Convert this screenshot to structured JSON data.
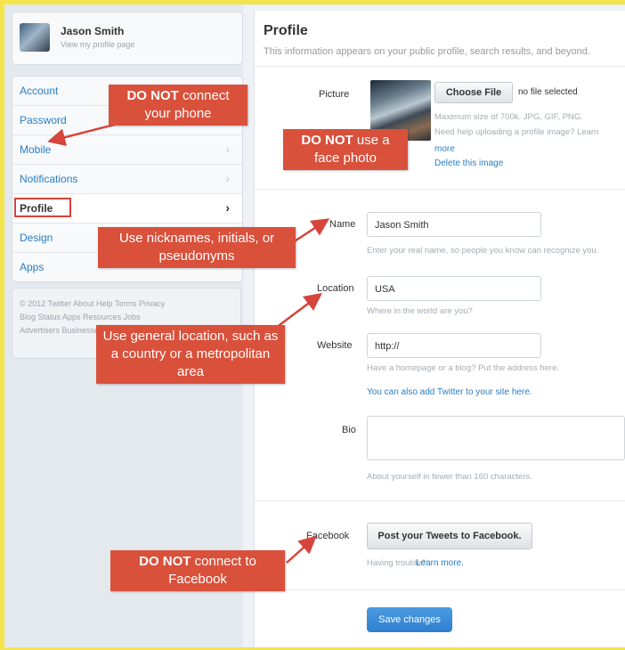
{
  "user": {
    "name": "Jason Smith",
    "subtitle": "View my profile page"
  },
  "nav": [
    {
      "label": "Account"
    },
    {
      "label": "Password"
    },
    {
      "label": "Mobile"
    },
    {
      "label": "Notifications"
    },
    {
      "label": "Profile",
      "active": true
    },
    {
      "label": "Design"
    },
    {
      "label": "Apps"
    }
  ],
  "footer": {
    "lines": [
      "© 2012 Twitter  About  Help  Terms  Privacy",
      "Blog  Status  Apps  Resources  Jobs",
      "Advertisers  Businesses  Media  Developers"
    ]
  },
  "profile": {
    "title": "Profile",
    "subtitle": "This information appears on your public profile, search results, and beyond.",
    "picture": {
      "label": "Picture",
      "choose_button": "Choose File",
      "no_file": "no file selected",
      "hint1": "Maximum size of 700k. JPG, GIF, PNG.",
      "hint2": "Need help uploading a profile image? Learn",
      "hint2_link": "more",
      "delete_link": "Delete this image"
    },
    "name": {
      "label": "Name",
      "value": "Jason Smith",
      "hint": "Enter your real name, so people you know can recognize you."
    },
    "location": {
      "label": "Location",
      "value": "USA",
      "hint": "Where in the world are you?"
    },
    "website": {
      "label": "Website",
      "value": "http://",
      "hint": "Have a homepage or a blog? Put the address here.",
      "link": "You can also add Twitter to your site here."
    },
    "bio": {
      "label": "Bio",
      "value": "",
      "hint": "About yourself in fewer than 160 characters."
    },
    "facebook": {
      "label": "Facebook",
      "button": "Post your Tweets to Facebook.",
      "hint": "Having trouble?",
      "hint_link": "Learn more."
    },
    "save_button": "Save changes"
  },
  "callouts": {
    "phone": {
      "strong": "DO NOT",
      "rest": " connect your phone"
    },
    "photo": {
      "strong": "DO NOT",
      "rest": " use a face photo"
    },
    "nickname": {
      "text": "Use nicknames, initials, or pseudonyms"
    },
    "location": {
      "text": "Use general location, such as a country or a metropolitan area"
    },
    "facebook": {
      "strong": "DO NOT",
      "rest": " connect to Facebook"
    }
  },
  "colors": {
    "background": "#f2e44a",
    "link": "#2a7ec3",
    "callout": "#d9503b",
    "save": "#2f7fcf"
  }
}
